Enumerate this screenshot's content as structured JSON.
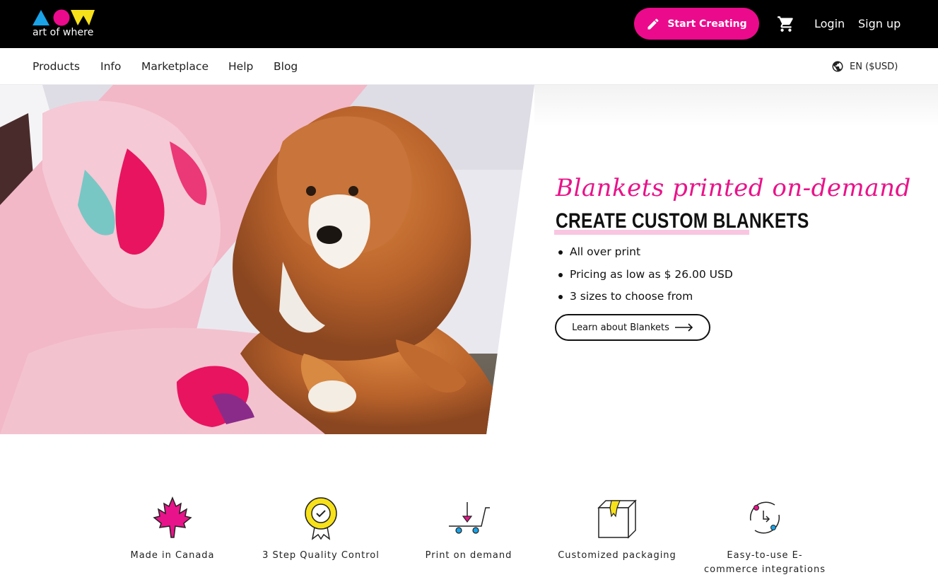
{
  "header": {
    "logo_text": "art of where",
    "start_creating_label": "Start Creating",
    "login_label": "Login",
    "signup_label": "Sign up"
  },
  "nav": {
    "items": [
      "Products",
      "Info",
      "Marketplace",
      "Help",
      "Blog"
    ],
    "language_label": "EN ($USD)"
  },
  "hero": {
    "script_title": "Blankets printed on-demand",
    "title": "CREATE CUSTOM BLANKETS",
    "bullets": [
      "All over print",
      "Pricing as low as $ 26.00 USD",
      "3 sizes to choose from"
    ],
    "cta_label": "Learn about Blankets"
  },
  "features": [
    {
      "label": "Made in Canada",
      "icon": "maple-leaf-icon"
    },
    {
      "label": "3 Step Quality Control",
      "icon": "quality-badge-icon"
    },
    {
      "label": "Print on demand",
      "icon": "cart-print-icon"
    },
    {
      "label": "Customized packaging",
      "icon": "box-icon"
    },
    {
      "label": "Easy-to-use E-commerce integrations",
      "icon": "sync-icon"
    }
  ],
  "colors": {
    "brand_pink": "#ec0a8c",
    "brand_blue": "#1aa3e8",
    "brand_yellow": "#f7e11a",
    "topbar_bg": "#000000"
  }
}
